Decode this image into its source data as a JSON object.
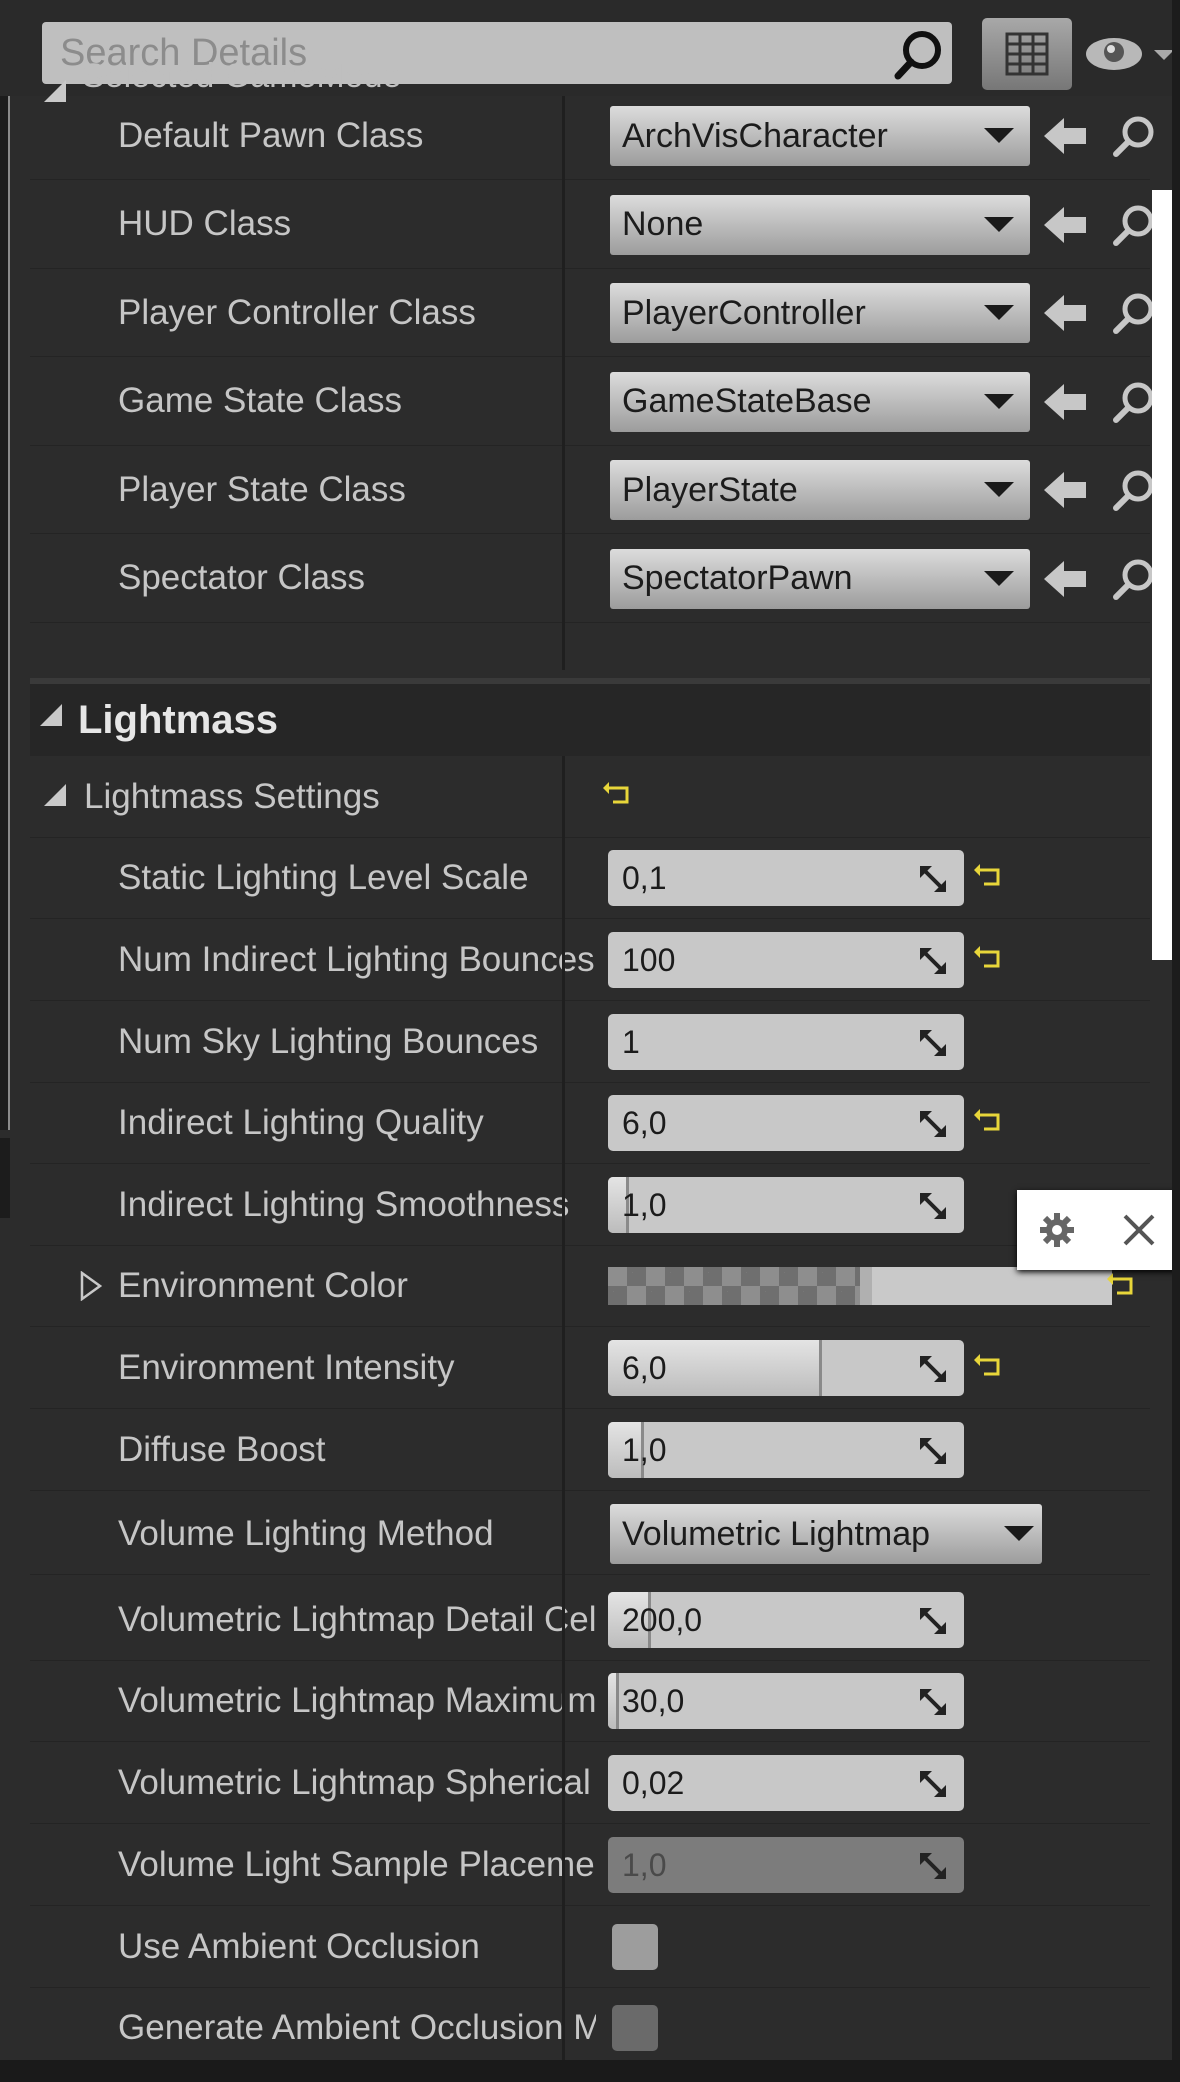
{
  "search": {
    "placeholder": "Search Details"
  },
  "game_mode": {
    "section_label": "Selected GameMode",
    "rows": [
      {
        "label": "Default Pawn Class",
        "value": "ArchVisCharacter"
      },
      {
        "label": "HUD Class",
        "value": "None"
      },
      {
        "label": "Player Controller Class",
        "value": "PlayerController"
      },
      {
        "label": "Game State Class",
        "value": "GameStateBase"
      },
      {
        "label": "Player State Class",
        "value": "PlayerState"
      },
      {
        "label": "Spectator Class",
        "value": "SpectatorPawn"
      }
    ]
  },
  "lightmass": {
    "title": "Lightmass",
    "settings_label": "Lightmass Settings",
    "rows": [
      {
        "label": "Static Lighting Level Scale",
        "value": "0,1",
        "fill": 0.0,
        "reset": true
      },
      {
        "label": "Num Indirect Lighting Bounces",
        "value": "100",
        "fill": 0.0,
        "reset": true
      },
      {
        "label": "Num Sky Lighting Bounces",
        "value": "1",
        "fill": 0.0,
        "reset": false
      },
      {
        "label": "Indirect Lighting Quality",
        "value": "6,0",
        "fill": 0.0,
        "reset": true
      },
      {
        "label": "Indirect Lighting Smoothness",
        "value": "1,0",
        "fill": 0.06,
        "reset": false
      },
      {
        "label": "Environment Color"
      },
      {
        "label": "Environment Intensity",
        "value": "6,0",
        "fill": 0.6,
        "reset": true
      },
      {
        "label": "Diffuse Boost",
        "value": "1,0",
        "fill": 0.1,
        "reset": false
      },
      {
        "label": "Volume Lighting Method",
        "value": "Volumetric Lightmap"
      },
      {
        "label": "Volumetric Lightmap Detail Cell Size",
        "value": "200,0",
        "fill": 0.12,
        "reset": false
      },
      {
        "label": "Volumetric Lightmap Maximum Brick Memory",
        "value": "30,0",
        "fill": 0.03,
        "reset": false
      },
      {
        "label": "Volumetric Lightmap Spherical Harmonic Smoothing",
        "value": "0,02",
        "fill": 0.0,
        "reset": false
      },
      {
        "label": "Volume Light Sample Placement Scale",
        "value": "1,0",
        "fill": 0.0,
        "reset": false
      },
      {
        "label": "Use Ambient Occlusion"
      },
      {
        "label": "Generate Ambient Occlusion Material Mask"
      }
    ]
  },
  "colors": {
    "reset_yellow": "#e8d63a",
    "panel_bg": "#2c2c2c"
  }
}
